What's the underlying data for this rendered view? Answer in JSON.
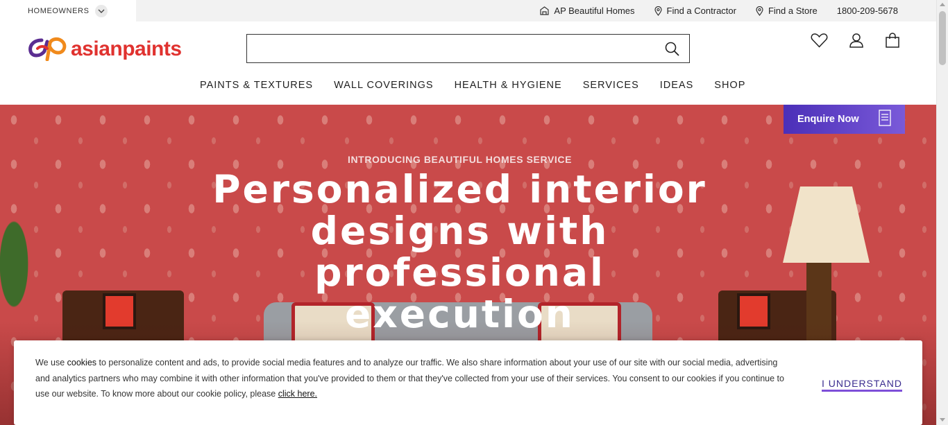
{
  "topbar": {
    "segment_label": "HOMEOWNERS",
    "links": [
      {
        "label": "AP Beautiful Homes",
        "icon": "beautiful-homes-icon"
      },
      {
        "label": "Find a Contractor",
        "icon": "location-pin-icon"
      },
      {
        "label": "Find a Store",
        "icon": "location-pin-icon"
      }
    ],
    "phone": "1800-209-5678"
  },
  "header": {
    "logo_text": "asianpaints",
    "search_value": "",
    "icons": [
      "wishlist-heart-icon",
      "account-user-icon",
      "cart-bag-icon"
    ]
  },
  "nav": {
    "items": [
      "PAINTS & TEXTURES",
      "WALL COVERINGS",
      "HEALTH & HYGIENE",
      "SERVICES",
      "IDEAS",
      "SHOP"
    ]
  },
  "hero": {
    "eyebrow": "INTRODUCING BEAUTIFUL HOMES SERVICE",
    "title": "Personalized interior designs with professional execution"
  },
  "enquire": {
    "label": "Enquire Now"
  },
  "cookie": {
    "text_prefix": "We use",
    "text_cookies": "cookies",
    "text_body": " to personalize content and ads, to provide social media features and to analyze our traffic. We also share information about your use of our site with our social media, advertising and analytics partners who may combine it with other information that you've provided to them or that they've collected from your use of their services. You consent to our cookies if you continue to use our website. To know more about our cookie policy, please ",
    "link_label": "click here.",
    "button_label": "I UNDERSTAND"
  },
  "colors": {
    "brand_red": "#e0322f",
    "enquire_purple": "#5a3cc8",
    "cookie_accent": "#7d4fd8"
  }
}
